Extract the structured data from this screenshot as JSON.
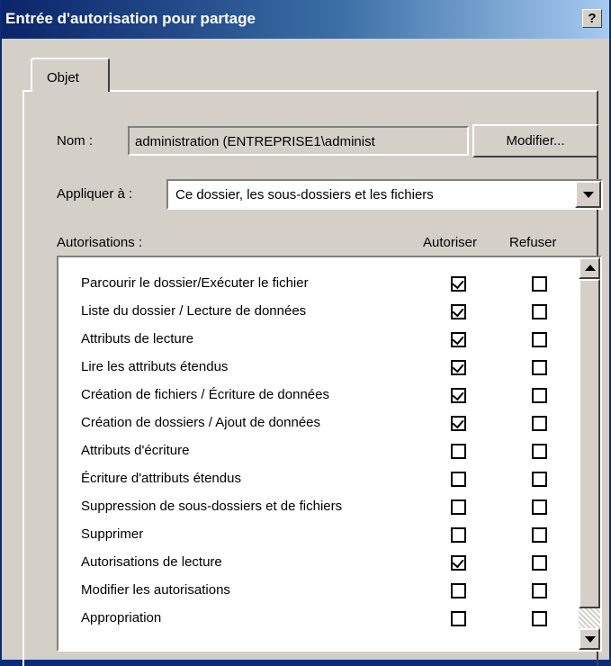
{
  "window": {
    "title": "Entrée d'autorisation pour partage",
    "help_label": "?"
  },
  "tabs": [
    {
      "label": "Objet"
    }
  ],
  "name_row": {
    "label": "Nom :",
    "value": "administration (ENTREPRISE1\\administ",
    "button_label": "Modifier..."
  },
  "apply_row": {
    "label": "Appliquer à :",
    "selected": "Ce dossier, les sous-dossiers et les fichiers"
  },
  "permissions": {
    "header_label": "Autorisations :",
    "col_allow": "Autoriser",
    "col_deny": "Refuser",
    "rows": [
      {
        "label": "Parcourir le dossier/Exécuter le fichier",
        "allow": true,
        "deny": false
      },
      {
        "label": "Liste du dossier / Lecture de données",
        "allow": true,
        "deny": false
      },
      {
        "label": "Attributs de lecture",
        "allow": true,
        "deny": false
      },
      {
        "label": "Lire les attributs étendus",
        "allow": true,
        "deny": false
      },
      {
        "label": "Création de fichiers / Écriture de données",
        "allow": true,
        "deny": false
      },
      {
        "label": "Création de dossiers / Ajout de données",
        "allow": true,
        "deny": false
      },
      {
        "label": "Attributs d'écriture",
        "allow": false,
        "deny": false
      },
      {
        "label": "Écriture d'attributs étendus",
        "allow": false,
        "deny": false
      },
      {
        "label": "Suppression de sous-dossiers et de fichiers",
        "allow": false,
        "deny": false
      },
      {
        "label": "Supprimer",
        "allow": false,
        "deny": false
      },
      {
        "label": "Autorisations de lecture",
        "allow": true,
        "deny": false
      },
      {
        "label": "Modifier les autorisations",
        "allow": false,
        "deny": false
      },
      {
        "label": "Appropriation",
        "allow": false,
        "deny": false
      }
    ]
  },
  "colors": {
    "title_gradient_start": "#0a246a",
    "title_gradient_end": "#a6caf0",
    "dialog_face": "#d4d0c8"
  }
}
